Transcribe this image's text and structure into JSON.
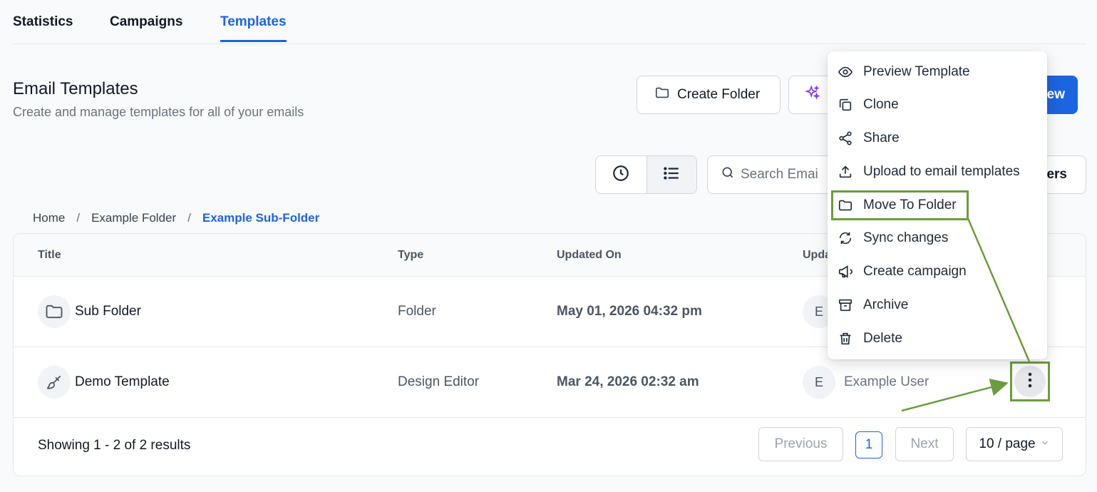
{
  "tabs": [
    {
      "label": "Statistics"
    },
    {
      "label": "Campaigns"
    },
    {
      "label": "Templates"
    }
  ],
  "header": {
    "title": "Email Templates",
    "subtitle": "Create and manage templates for all of your emails"
  },
  "toolbar": {
    "create_folder_label": "Create Folder",
    "new_label": "ew",
    "search_placeholder": "Search Emai",
    "filters_label": "ers"
  },
  "breadcrumb": [
    {
      "label": "Home"
    },
    {
      "label": "Example Folder"
    },
    {
      "label": "Example Sub-Folder"
    }
  ],
  "breadcrumb_separator": "/",
  "table": {
    "columns": [
      "Title",
      "Type",
      "Updated On",
      "Upda"
    ],
    "rows": [
      {
        "title": "Sub Folder",
        "type": "Folder",
        "updated_on": "May 01, 2026 04:32 pm",
        "avatar": "E",
        "user": ""
      },
      {
        "title": "Demo Template",
        "type": "Design Editor",
        "updated_on": "Mar 24, 2026 02:32 am",
        "avatar": "E",
        "user": "Example User"
      }
    ]
  },
  "pagination": {
    "summary": "Showing 1 - 2 of 2 results",
    "previous": "Previous",
    "current": "1",
    "next": "Next",
    "page_size": "10 / page"
  },
  "menu": {
    "items": [
      {
        "label": "Preview Template",
        "icon": "eye-icon"
      },
      {
        "label": "Clone",
        "icon": "copy-icon"
      },
      {
        "label": "Share",
        "icon": "share-icon"
      },
      {
        "label": "Upload to email templates",
        "icon": "upload-icon"
      },
      {
        "label": "Move To Folder",
        "icon": "folder-icon"
      },
      {
        "label": "Sync changes",
        "icon": "sync-icon"
      },
      {
        "label": "Create campaign",
        "icon": "megaphone-icon"
      },
      {
        "label": "Archive",
        "icon": "archive-icon"
      },
      {
        "label": "Delete",
        "icon": "trash-icon"
      }
    ]
  },
  "colors": {
    "accent": "#1d64e0",
    "annotation": "#6a9e3c",
    "ai_icon": "#7c3aed"
  }
}
